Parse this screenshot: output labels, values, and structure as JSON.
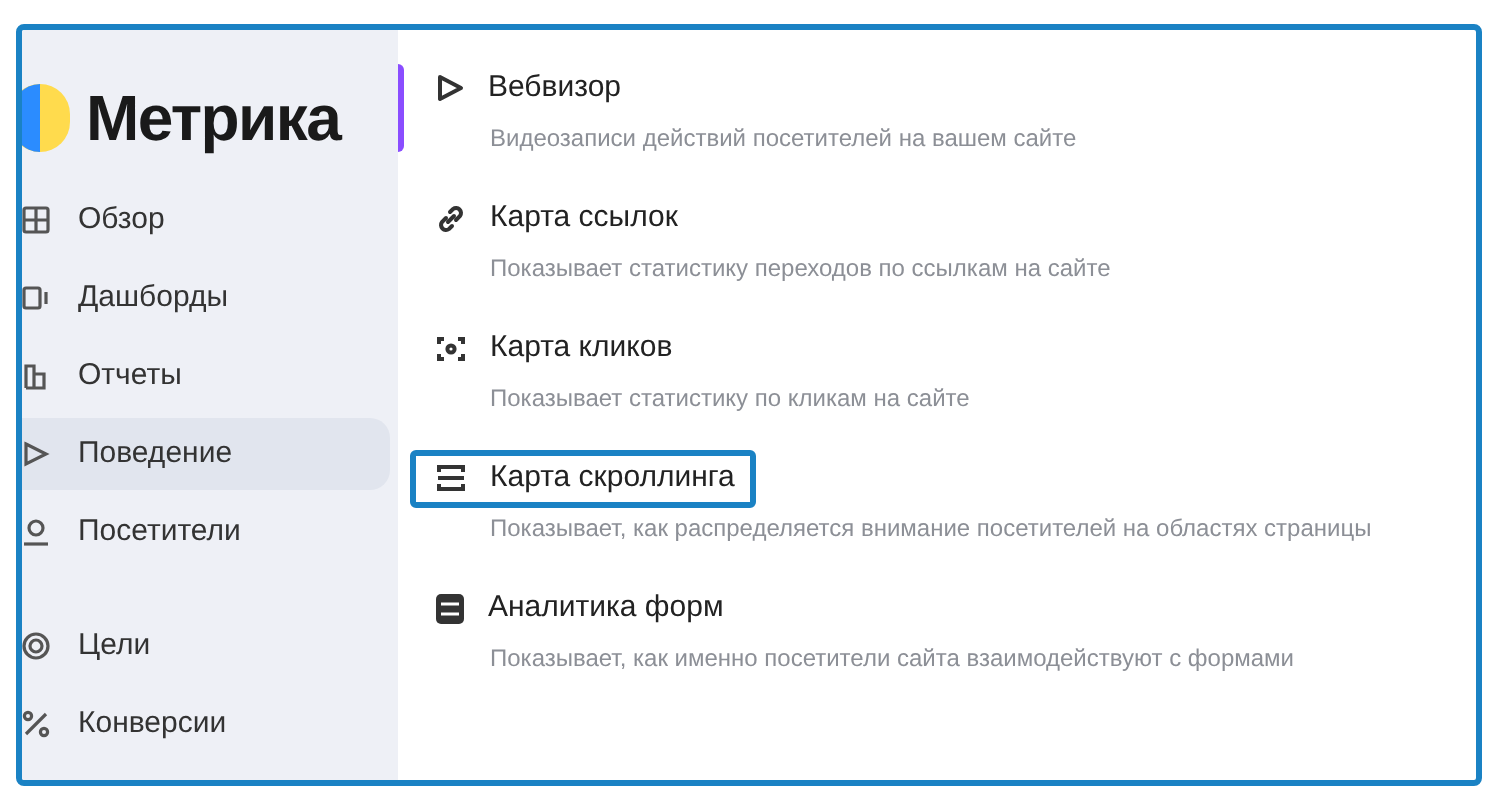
{
  "logo": {
    "text": "Метрика"
  },
  "nav_groups": [
    {
      "items": [
        {
          "label": "Обзор",
          "selected": false
        },
        {
          "label": "Дашборды",
          "selected": false
        },
        {
          "label": "Отчеты",
          "selected": false
        },
        {
          "label": "Поведение",
          "selected": true
        },
        {
          "label": "Посетители",
          "selected": false
        }
      ]
    },
    {
      "items": [
        {
          "label": "Цели",
          "selected": false
        },
        {
          "label": "Конверсии",
          "selected": false
        }
      ]
    }
  ],
  "menu": [
    {
      "title": "Вебвизор",
      "description": "Видеозаписи действий посетителей на вашем сайте",
      "active": true,
      "highlighted": false
    },
    {
      "title": "Карта ссылок",
      "description": "Показывает статистику переходов по ссылкам на сайте",
      "active": false,
      "highlighted": false
    },
    {
      "title": "Карта кликов",
      "description": "Показывает статистику по кликам на сайте",
      "active": false,
      "highlighted": false
    },
    {
      "title": "Карта скроллинга",
      "description": "Показывает, как распределяется внимание посетителей на областях страницы",
      "active": false,
      "highlighted": true
    },
    {
      "title": "Аналитика форм",
      "description": "Показывает, как именно посетители сайта взаимодействуют с формами",
      "active": false,
      "highlighted": false
    }
  ]
}
